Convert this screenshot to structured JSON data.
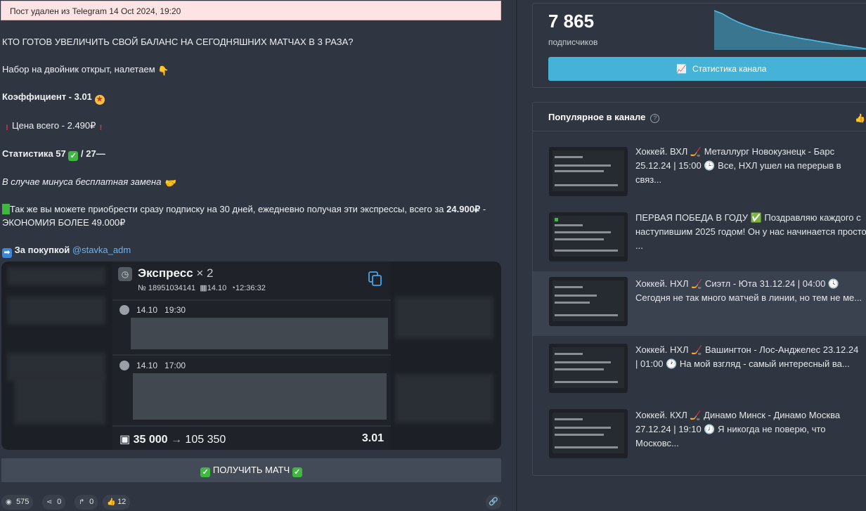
{
  "banner": {
    "prefix": "Пост удален из Telegram",
    "date": "14 Oct 2024, 19:20"
  },
  "post": {
    "headline": "КТО ГОТОВ УВЕЛИЧИТЬ СВОЙ БАЛАНС НА СЕГОДНЯШНИХ МАТЧАХ В 3 РАЗА?",
    "line_double": "Набор на двойник открыт, налетаем",
    "coef_label": "Коэффициент - 3.01",
    "price_label": "Цена всего - 2.490₽",
    "stats_label": "Статистика 57",
    "stats_rest": "/ 27",
    "replacement": "В случае минуса бесплатная замена",
    "sub_text_1": "Так же вы можете приобрести сразу подписку на 30 дней, ежедневно получая эти экспрессы, всего за",
    "sub_price": "24.900₽",
    "sub_text_2": "- ЭКОНОМИЯ БОЛЕЕ 49.000₽",
    "buy_label": "За покупкой",
    "buy_link": "@stavka_adm"
  },
  "bet_card": {
    "title": "Экспресс",
    "multiplier": "× 2",
    "number": "№ 18951034141",
    "date": "14.10",
    "time": "12:36:32",
    "legs": [
      {
        "date": "14.10",
        "time": "19:30"
      },
      {
        "date": "14.10",
        "time": "17:00"
      }
    ],
    "stake": "35 000",
    "arrow": "→",
    "payout": "105 350",
    "odds": "3.01"
  },
  "get_match_label": "ПОЛУЧИТЬ МАТЧ",
  "stats": {
    "views": "575",
    "shares": "0",
    "forwards": "0",
    "likes": "12"
  },
  "subscribers": {
    "count": "7 865",
    "label": "подписчиков",
    "button": "Статистика канала",
    "trend": [
      100,
      92,
      80,
      70,
      62,
      55,
      49,
      44,
      40,
      36,
      32,
      28,
      25,
      21,
      18,
      14,
      11,
      8,
      5,
      2
    ]
  },
  "popular": {
    "title": "Популярное в канале",
    "items": [
      {
        "line1": "Хоккей. ВХЛ 🏒 Металлург Новокузнецк - Барс",
        "line2": "25.12.24 | 15:00 🕒 Все, НХЛ ушел на перерыв в",
        "line3": "связ..."
      },
      {
        "line1": "ПЕРВАЯ ПОБЕДА В ГОДУ ✅ Поздравляю каждого с",
        "line2": "наступившим 2025 годом! Он у нас начинается просто",
        "line3": "..."
      },
      {
        "line1": "Хоккей. НХЛ 🏒 Сиэтл - Юта 31.12.24 | 04:00 🕓",
        "line2": "Сегодня не так много матчей в линии, но тем не ме...",
        "line3": ""
      },
      {
        "line1": "Хоккей. НХЛ 🏒 Вашингтон - Лос-Анджелес 23.12.24",
        "line2": "| 01:00 🕐 На мой взгляд - самый интересный ва...",
        "line3": ""
      },
      {
        "line1": "Хоккей. КХЛ 🏒 Динамо Минск - Динамо Москва",
        "line2": "27.12.24 | 19:10 🕖 Я никогда не поверю, что",
        "line3": "Московс..."
      }
    ]
  },
  "colors": {
    "page_bg": "#2f3642",
    "accent_button": "#45b3d7",
    "banner_bg": "#fde3e4",
    "link": "#6ab3f3"
  }
}
